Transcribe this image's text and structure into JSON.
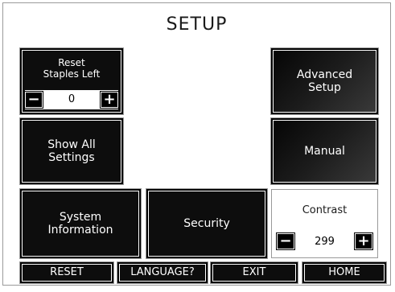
{
  "title": "SETUP",
  "reset_staples": {
    "label": "Reset\nStaples Left",
    "value": "0",
    "minus": "−",
    "plus": "+"
  },
  "buttons": {
    "advanced_setup": "Advanced\nSetup",
    "show_all_settings": "Show  All\nSettings",
    "manual": "Manual",
    "system_information": "System\nInformation",
    "security": "Security"
  },
  "contrast": {
    "label": "Contrast",
    "value": "299",
    "minus": "−",
    "plus": "+"
  },
  "bottom_bar": {
    "reset": "RESET",
    "language": "LANGUAGE?",
    "exit": "EXIT",
    "home": "HOME"
  }
}
